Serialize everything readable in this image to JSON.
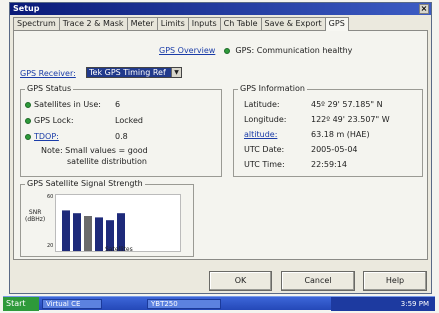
{
  "window": {
    "title": "Setup",
    "close": "×"
  },
  "tabs": [
    "Spectrum",
    "Trace 2 & Mask",
    "Meter",
    "Limits",
    "Inputs",
    "Ch Table",
    "Save & Export",
    "GPS"
  ],
  "header": {
    "overview_link": "GPS Overview",
    "status_text": "GPS: Communication healthy"
  },
  "receiver": {
    "label": "GPS Receiver:",
    "value": "Tek GPS Timing Ref",
    "arrow": "▼"
  },
  "gps_status": {
    "title": "GPS Status",
    "satellites_label": "Satellites in Use:",
    "satellites_value": "6",
    "lock_label": "GPS Lock:",
    "lock_value": "Locked",
    "tdop_label": "TDOP:",
    "tdop_value": "0.8",
    "note_line1": "Note: Small values = good",
    "note_line2": "satellite distribution"
  },
  "gps_info": {
    "title": "GPS Information",
    "rows": [
      {
        "label": "Latitude:",
        "value": "45º 29' 57.185\" N"
      },
      {
        "label": "Longitude:",
        "value": "122º 49' 23.507\" W"
      },
      {
        "label": "altitude:",
        "value": "63.18 m (HAE)"
      },
      {
        "label": "UTC Date:",
        "value": "2005-05-04"
      },
      {
        "label": "UTC Time:",
        "value": "22:59:14"
      }
    ]
  },
  "signal_strength": {
    "title": "GPS Satellite Signal Strength",
    "ylabel_1": "SNR",
    "ylabel_2": "(dBHz)",
    "ytick_top": "60",
    "ytick_bottom": "20",
    "xlabel": "Satellites"
  },
  "chart_data": {
    "type": "bar",
    "title": "GPS Satellite Signal Strength",
    "xlabel": "Satellites",
    "ylabel": "SNR (dBHz)",
    "ylim": [
      20,
      60
    ],
    "values": [
      49,
      47,
      45,
      44,
      42,
      47
    ],
    "colors": [
      "#1e2a7a",
      "#1e2a7a",
      "#6b6b6b",
      "#1e2a7a",
      "#1e2a7a",
      "#1e2a7a"
    ]
  },
  "buttons": {
    "ok": "OK",
    "cancel": "Cancel",
    "help": "Help"
  },
  "taskbar": {
    "start": "Start",
    "task1": "Virtual CE",
    "task2": "YBT250",
    "time": "3:59 PM"
  },
  "colors": {
    "status_ok": "#2e9a3a",
    "title_bar": "#0a1a78",
    "link": "#1a3ca8"
  }
}
